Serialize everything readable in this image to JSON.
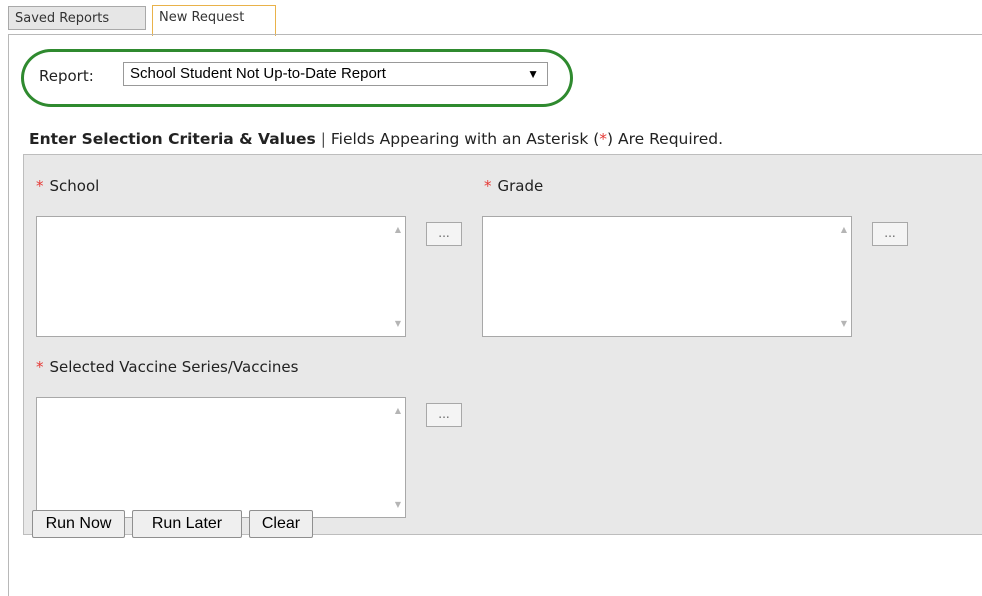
{
  "tabs": [
    {
      "label": "Saved Reports"
    },
    {
      "label": "New Request"
    }
  ],
  "report": {
    "label": "Report:",
    "selected": "School Student Not Up-to-Date Report"
  },
  "criteria": {
    "title": "Enter Selection Criteria & Values",
    "separator": "|",
    "note_prefix": "Fields Appearing with an Asterisk (",
    "note_star": "*",
    "note_suffix": ") Are Required."
  },
  "fields": {
    "school": {
      "label": "School",
      "required_mark": "*",
      "picker": "..."
    },
    "grade": {
      "label": "Grade",
      "required_mark": "*",
      "picker": "..."
    },
    "vaccines": {
      "label": "Selected Vaccine Series/Vaccines",
      "required_mark": "*",
      "picker": "..."
    }
  },
  "actions": {
    "run_now": "Run Now",
    "run_later": "Run Later",
    "clear": "Clear"
  },
  "colors": {
    "highlight_oval": "#2f8a2f",
    "required_star": "#e53935",
    "active_tab_border": "#e9b24a"
  }
}
